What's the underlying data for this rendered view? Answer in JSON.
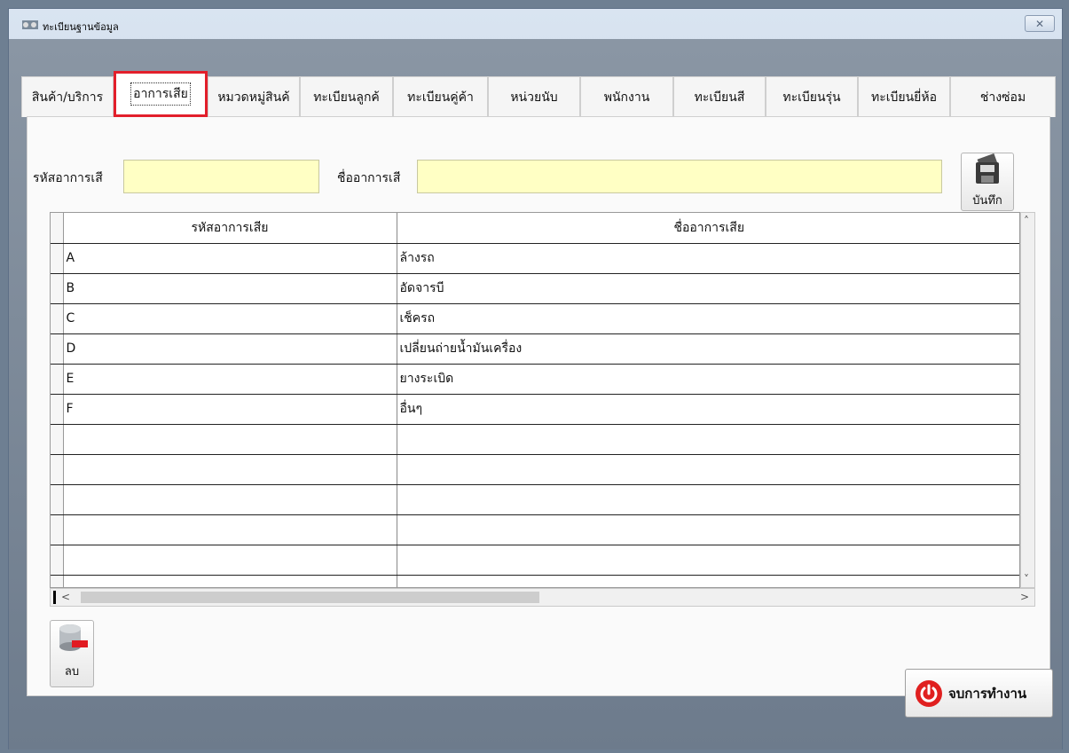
{
  "window": {
    "title": "ทะเบียนฐานข้อมูล",
    "close_symbol": "✕"
  },
  "tabs": [
    {
      "label": "สินค้า/บริการ",
      "active": false
    },
    {
      "label": "อาการเสีย",
      "active": true
    },
    {
      "label": "หมวดหมู่สินค้",
      "active": false
    },
    {
      "label": "ทะเบียนลูกค้",
      "active": false
    },
    {
      "label": "ทะเบียนคู่ค้า",
      "active": false
    },
    {
      "label": "หน่วยนับ",
      "active": false
    },
    {
      "label": "พนักงาน",
      "active": false
    },
    {
      "label": "ทะเบียนสี",
      "active": false
    },
    {
      "label": "ทะเบียนรุ่น",
      "active": false
    },
    {
      "label": "ทะเบียนยี่ห้อ",
      "active": false
    },
    {
      "label": "ช่างซ่อม",
      "active": false
    }
  ],
  "form": {
    "code_label": "รหัสอาการเสี",
    "code_value": "",
    "name_label": "ชื่ออาการเสี",
    "name_value": "",
    "save_label": "บันทึก"
  },
  "table": {
    "headers": [
      "รหัสอาการเสีย",
      "ชื่ออาการเสีย"
    ],
    "rows": [
      [
        "A",
        "ล้างรถ"
      ],
      [
        "B",
        "อัดจารบี"
      ],
      [
        "C",
        "เช็ครถ"
      ],
      [
        "D",
        "เปลี่ยนถ่ายน้ำมันเครื่อง"
      ],
      [
        "E",
        "ยางระเบิด"
      ],
      [
        "F",
        "อื่นๆ"
      ],
      [
        "",
        ""
      ],
      [
        "",
        ""
      ],
      [
        "",
        ""
      ],
      [
        "",
        ""
      ],
      [
        "",
        ""
      ],
      [
        "",
        ""
      ]
    ]
  },
  "actions": {
    "delete_label": "ลบ",
    "exit_label": "จบการทำงาน"
  },
  "colors": {
    "input_bg": "#ffffc4",
    "active_tab_border": "#e21f2b",
    "exit_icon": "#e02020"
  }
}
